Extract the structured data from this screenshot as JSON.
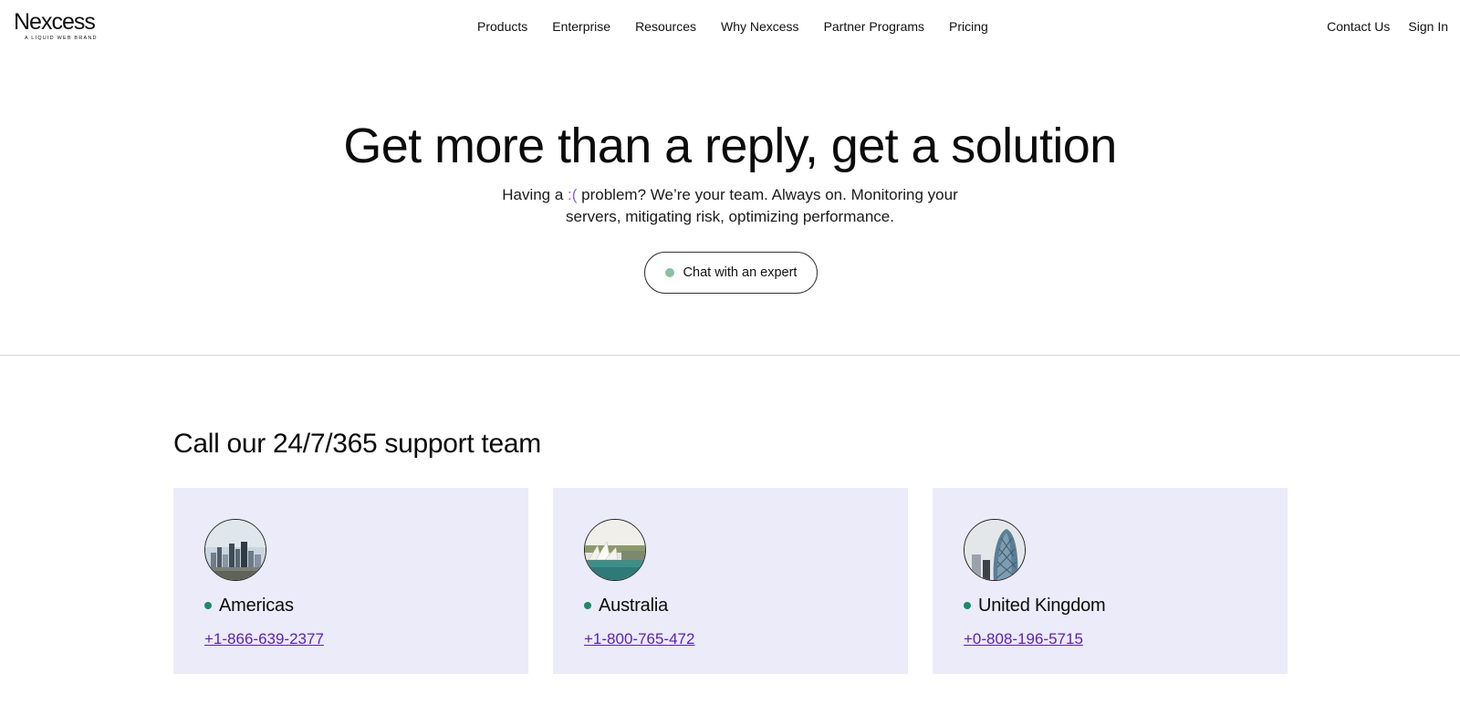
{
  "header": {
    "logo_text": "Nexcess",
    "logo_subtext": "A LIQUID WEB BRAND",
    "nav": [
      "Products",
      "Enterprise",
      "Resources",
      "Why Nexcess",
      "Partner Programs",
      "Pricing"
    ],
    "contact_label": "Contact Us",
    "signin_label": "Sign In"
  },
  "hero": {
    "title": "Get more than a reply, get a solution",
    "subtitle_pre": "Having a ",
    "subtitle_emoticon": ":(",
    "subtitle_post": " problem? We’re your team. Always on. Monitoring your servers, mitigating risk, optimizing performance.",
    "chat_button_label": "Chat with an expert"
  },
  "support": {
    "title": "Call our 24/7/365 support team",
    "cards": [
      {
        "region": "Americas",
        "phone": "+1-866-639-2377",
        "image_icon": "city-skyline-image"
      },
      {
        "region": "Australia",
        "phone": "+1-800-765-472",
        "image_icon": "sydney-opera-house-image"
      },
      {
        "region": "United Kingdom",
        "phone": "+0-808-196-5715",
        "image_icon": "london-gherkin-image"
      }
    ]
  },
  "colors": {
    "card_bg": "#ebebf9",
    "phone_link": "#5b21b6",
    "status_dot": "#1a8a6a",
    "chat_dot": "#8dbfa6",
    "emoticon": "#8b5cf6"
  }
}
